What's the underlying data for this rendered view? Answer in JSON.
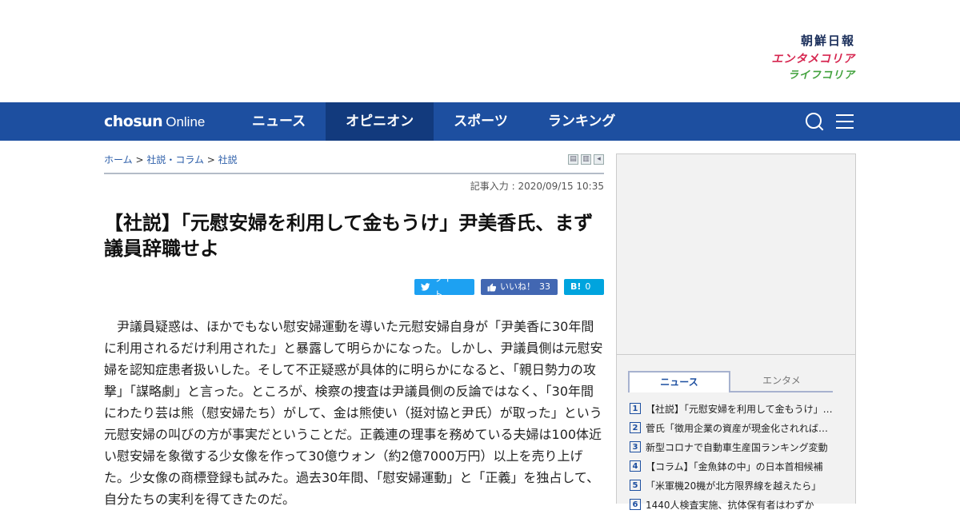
{
  "brands": {
    "chosun": "朝鮮日報",
    "entame": "エンタメコリア",
    "life": "ライフコリア"
  },
  "nav": {
    "logo_main": "chosun",
    "logo_sub": "Online",
    "items": [
      {
        "label": "ニュース",
        "active": false
      },
      {
        "label": "オピニオン",
        "active": true
      },
      {
        "label": "スポーツ",
        "active": false
      },
      {
        "label": "ランキング",
        "active": false
      }
    ]
  },
  "breadcrumb": {
    "home": "ホーム",
    "sep": " > ",
    "section": "社説・コラム",
    "sub": "社説"
  },
  "article": {
    "date": "記事入力 : 2020/09/15 10:35",
    "title": "【社説】「元慰安婦を利用して金もうけ」尹美香氏、まず議員辞職せよ",
    "share": {
      "tweet": "ツイート",
      "like": "いいね！",
      "like_count": "33",
      "hatena": "B!",
      "hatena_count": "0"
    },
    "body": "尹議員疑惑は、ほかでもない慰安婦運動を導いた元慰安婦自身が「尹美香に30年間に利用されるだけ利用された」と暴露して明らかになった。しかし、尹議員側は元慰安婦を認知症患者扱いした。そして不正疑惑が具体的に明らかになると、「親日勢力の攻撃」「謀略劇」と言った。ところが、検察の捜査は尹議員側の反論ではなく、「30年間にわたり芸は熊（慰安婦たち）がして、金は熊使い（挺対協と尹氏）が取った」という元慰安婦の叫びの方が事実だということだ。正義連の理事を務めている夫婦は100体近い慰安婦を象徴する少女像を作って30億ウォン（約2億7000万円）以上を売り上げた。少女像の商標登録も試みた。過去30年間、「慰安婦運動」と「正義」を独占して、自分たちの実利を得てきたのだ。"
  },
  "sidebar": {
    "tabs": [
      "ニュース",
      "エンタメ"
    ],
    "ranking": [
      {
        "n": "1",
        "title": "【社説】「元慰安婦を利用して金もうけ」尹美香氏、まず議員辞職せよ"
      },
      {
        "n": "2",
        "title": "菅氏「徴用企業の資産が現金化されれば日韓関係に深刻な事態」"
      },
      {
        "n": "3",
        "title": "新型コロナで自動車生産国ランキング変動"
      },
      {
        "n": "4",
        "title": "【コラム】「金魚鉢の中」の日本首相候補"
      },
      {
        "n": "5",
        "title": "「米軍機20機が北方限界線を越えたら」"
      },
      {
        "n": "6",
        "title": "1440人検査実施、抗体保有者はわずか"
      }
    ]
  }
}
